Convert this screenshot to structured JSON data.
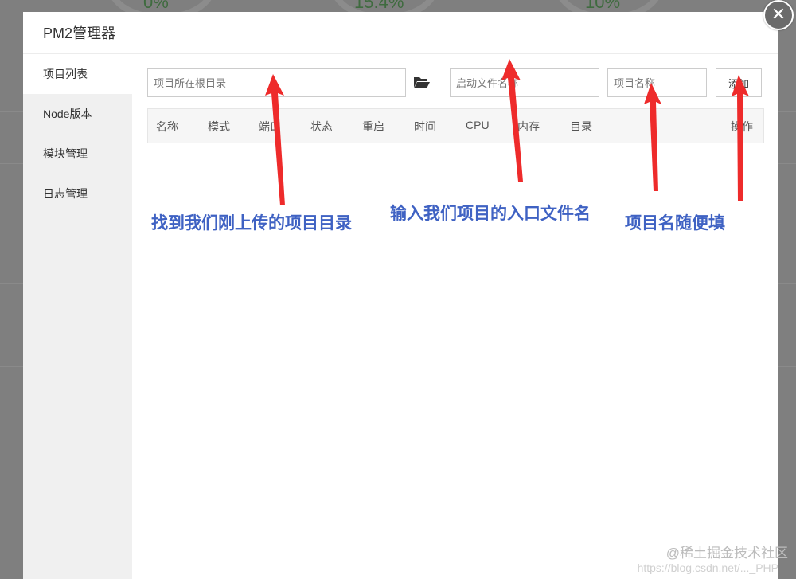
{
  "background": {
    "stats": [
      "0%",
      "15.4%",
      "10%"
    ]
  },
  "modal": {
    "title": "PM2管理器",
    "close_icon": "close-icon"
  },
  "sidebar": {
    "items": [
      {
        "label": "项目列表",
        "active": true
      },
      {
        "label": "Node版本",
        "active": false
      },
      {
        "label": "模块管理",
        "active": false
      },
      {
        "label": "日志管理",
        "active": false
      }
    ]
  },
  "toolbar": {
    "root_dir_placeholder": "项目所在根目录",
    "folder_icon": "folder-open-icon",
    "entry_file_placeholder": "启动文件名称",
    "project_name_placeholder": "项目名称",
    "add_label": "添加"
  },
  "table": {
    "headers": [
      "名称",
      "模式",
      "端口",
      "状态",
      "重启",
      "时间",
      "CPU",
      "内存",
      "目录",
      "操作"
    ]
  },
  "annotations": {
    "root_dir": "找到我们刚上传的项目目录",
    "entry_file": "输入我们项目的入口文件名",
    "project_name": "项目名随便填"
  },
  "colors": {
    "annotation": "#3f62c3",
    "arrow": "#ee2b2b"
  },
  "watermark": {
    "brand": "@稀土掘金技术社区",
    "url": "https://blog.csdn.net/..._PHP"
  }
}
